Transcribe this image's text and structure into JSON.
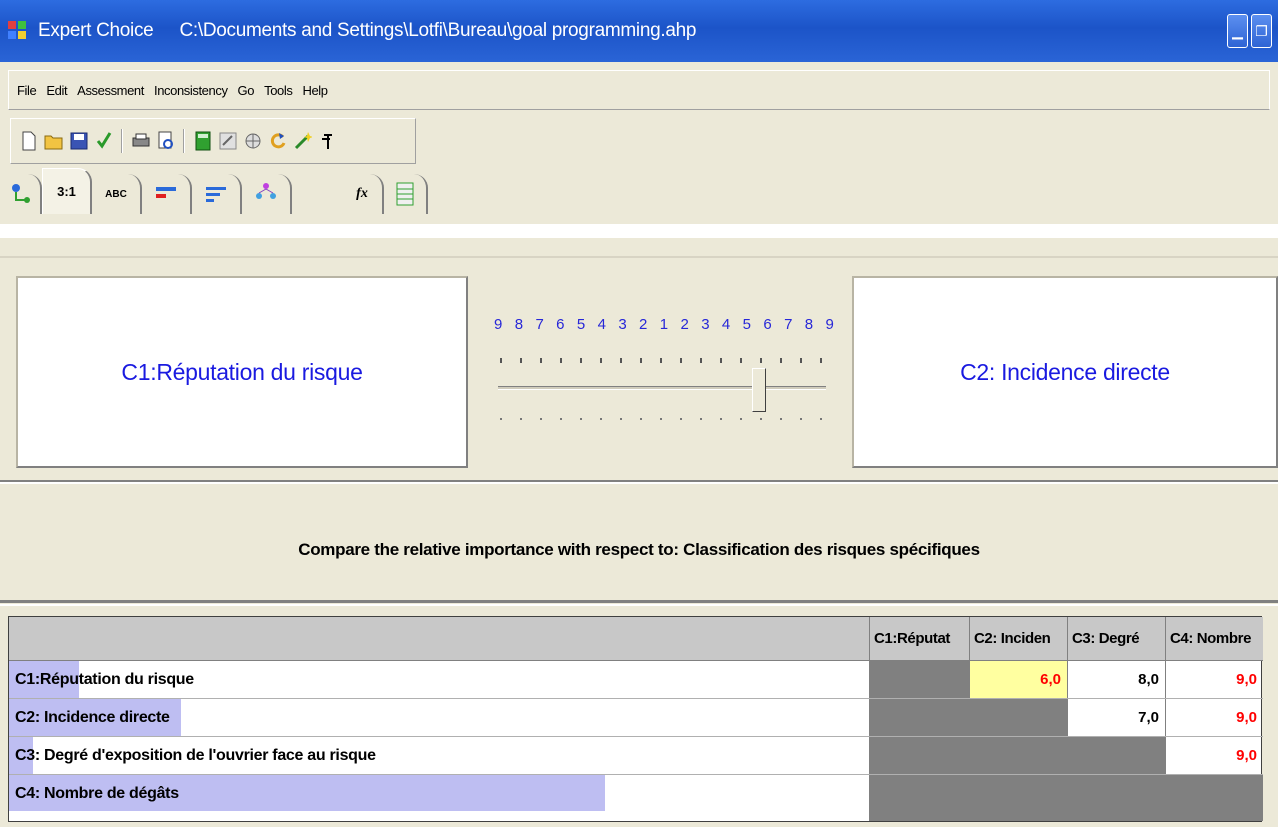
{
  "window": {
    "app_name": "Expert Choice",
    "file_path": "C:\\Documents and Settings\\Lotfi\\Bureau\\goal programming.ahp",
    "min_btn": "▁",
    "restore_btn": "❐"
  },
  "menu": [
    "File",
    "Edit",
    "Assessment",
    "Inconsistency",
    "Go",
    "Tools",
    "Help"
  ],
  "toolbar": {
    "buttons": [
      "new-file-icon",
      "open-folder-icon",
      "save-icon",
      "check-icon",
      "print-icon",
      "print-preview-icon",
      "calculator-icon",
      "compare-icon",
      "globe-icon",
      "refresh-icon",
      "wand-icon",
      "arrow-icon"
    ]
  },
  "tabs": {
    "tree": "",
    "numerical": "3:1",
    "verbal": "ABC",
    "graphical": "",
    "questionnaire": "",
    "formula": "fx"
  },
  "comparison": {
    "left_element": "C1:Réputation du risque",
    "right_element": "C2: Incidence directe",
    "scale": [
      "9",
      "8",
      "7",
      "6",
      "5",
      "4",
      "3",
      "2",
      "1",
      "2",
      "3",
      "4",
      "5",
      "6",
      "7",
      "8",
      "9"
    ],
    "instruction": "Compare the relative importance with respect to: Classification des risques spécifiques"
  },
  "matrix": {
    "columns": [
      "C1:Réputat",
      "C2: Inciden",
      "C3: Degré",
      "C4: Nombre"
    ],
    "rows": [
      {
        "label": "C1:Réputation du risque",
        "cells": [
          "",
          "6,0",
          "8,0",
          "9,0"
        ]
      },
      {
        "label": "C2: Incidence directe",
        "cells": [
          "",
          "",
          "7,0",
          "9,0"
        ]
      },
      {
        "label": "C3: Degré d'exposition de l'ouvrier face au  risque",
        "cells": [
          "",
          "",
          "",
          "9,0"
        ]
      },
      {
        "label": "C4: Nombre de dégâts",
        "cells": [
          "",
          "",
          "",
          ""
        ]
      }
    ]
  },
  "colors": {
    "title_bar": "#1C54C8",
    "element_text": "#1A1AE0",
    "inverse_value": "#FF0000",
    "selected_cell": "#FFFFA0",
    "row_bar": "#BEBEF2"
  }
}
